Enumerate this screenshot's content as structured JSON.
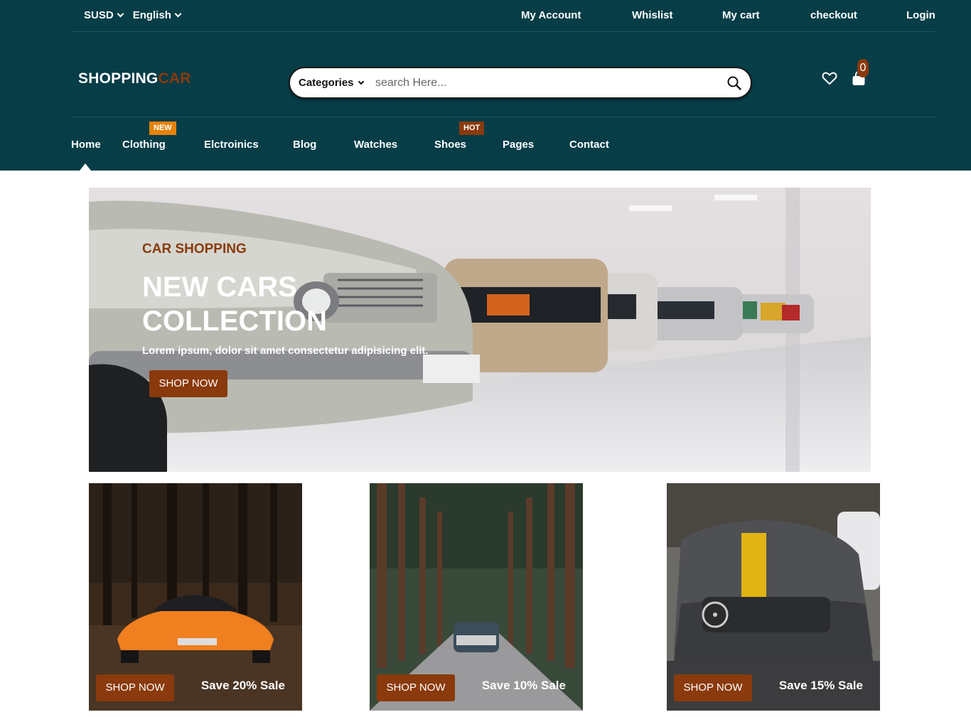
{
  "topbar": {
    "currency": "SUSD",
    "language": "English",
    "links": [
      "My Account",
      "Whislist",
      "My cart",
      "checkout",
      "Login"
    ]
  },
  "logo": {
    "part1": "SHOPPING",
    "part2": "CAR"
  },
  "search": {
    "category_label": "Categories",
    "placeholder": "search Here..."
  },
  "cart": {
    "count": "0"
  },
  "nav": {
    "items": [
      "Home",
      "Clothing",
      "Elctroinics",
      "Blog",
      "Watches",
      "Shoes",
      "Pages",
      "Contact"
    ],
    "badges": {
      "clothing": "NEW",
      "shoes": "HOT"
    }
  },
  "hero": {
    "subtitle": "CAR SHOPPING",
    "title_line1": "NEW CARS",
    "title_line2": "COLLECTION",
    "description": "Lorem ipsum, dolor sit amet consectetur adipisicing elit.",
    "button": "SHOP NOW"
  },
  "products": [
    {
      "button": "SHOP NOW",
      "sale": "Save 20% Sale"
    },
    {
      "button": "SHOP NOW",
      "sale": "Save 10% Sale"
    },
    {
      "button": "SHOP NOW",
      "sale": "Save 15% Sale"
    }
  ],
  "colors": {
    "header_bg": "#063d47",
    "accent": "#8a3a0c",
    "badge_new": "#e5820a"
  }
}
